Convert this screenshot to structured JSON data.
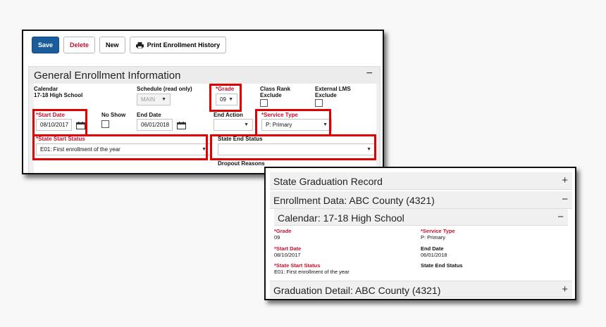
{
  "toolbar": {
    "save": "Save",
    "delete": "Delete",
    "new": "New",
    "print": "Print Enrollment History"
  },
  "general": {
    "title": "General Enrollment Information",
    "toggle": "−",
    "calendar_label": "Calendar",
    "calendar_value": "17-18 High School",
    "schedule_label": "Schedule (read only)",
    "schedule_value": "MAIN",
    "grade_label": "*Grade",
    "grade_value": "09",
    "class_rank_label": "Class Rank Exclude",
    "external_lms_label": "External LMS Exclude",
    "start_date_label": "*Start Date",
    "start_date_value": "08/10/2017",
    "no_show_label": "No Show",
    "end_date_label": "End Date",
    "end_date_value": "06/01/2018",
    "end_action_label": "End Action",
    "end_action_value": "",
    "service_type_label": "*Service Type",
    "service_type_value": "P: Primary",
    "state_start_label": "*State Start Status",
    "state_start_value": "E01: First enrollment of the year",
    "state_end_label": "State End Status",
    "state_end_value": "",
    "dropout_label": "Dropout Reasons"
  },
  "summary": {
    "graduation_record": "State Graduation Record",
    "graduation_record_toggle": "+",
    "enrollment_data": "Enrollment Data: ABC County (4321)",
    "enrollment_data_toggle": "−",
    "calendar": "Calendar: 17-18 High School",
    "calendar_toggle": "−",
    "grade_label": "*Grade",
    "grade_value": "09",
    "service_type_label": "*Service Type",
    "service_type_value": "P: Primary",
    "start_date_label": "*Start Date",
    "start_date_value": "08/10/2017",
    "end_date_label": "End Date",
    "end_date_value": "06/01/2018",
    "state_start_label": "*State Start Status",
    "state_start_value": "E01: First enrollment of the year",
    "state_end_label": "State End Status",
    "graduation_detail": "Graduation Detail: ABC County (4321)",
    "graduation_detail_toggle": "+"
  },
  "icons": {
    "printer": "printer-icon",
    "calendar": "calendar-icon",
    "dropdown": "chevron-down-icon"
  },
  "colors": {
    "save_button": "#1b5c9c",
    "required_label": "#c8102e",
    "highlight": "#e10000"
  }
}
